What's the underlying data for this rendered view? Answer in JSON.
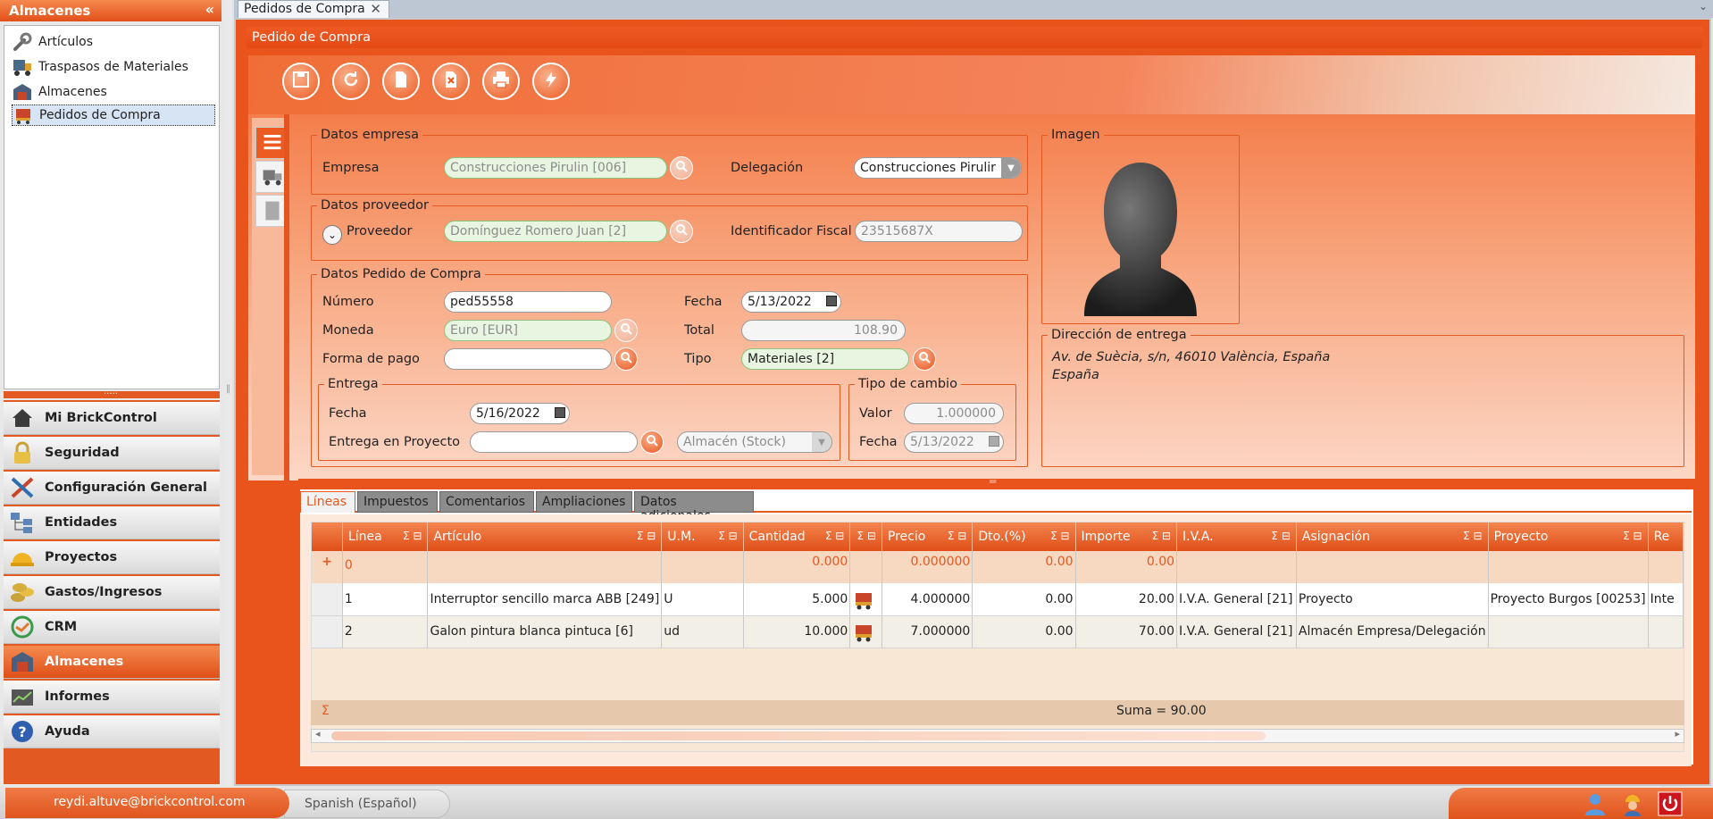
{
  "sidebar": {
    "title": "Almacenes",
    "collapse_icon": "«",
    "tree_items": [
      {
        "label": "Artículos",
        "icon": "wrench-icon"
      },
      {
        "label": "Traspasos de Materiales",
        "icon": "truck-icon"
      },
      {
        "label": "Almacenes",
        "icon": "warehouse-icon"
      },
      {
        "label": "Pedidos de Compra",
        "icon": "shopping-cart-icon"
      }
    ],
    "splitter_grip": ".....",
    "nav_items": [
      {
        "label": "Mi BrickControl",
        "icon": "house-icon"
      },
      {
        "label": "Seguridad",
        "icon": "padlock-icon"
      },
      {
        "label": "Configuración General",
        "icon": "tools-icon"
      },
      {
        "label": "Entidades",
        "icon": "org-chart-icon"
      },
      {
        "label": "Proyectos",
        "icon": "hard-hat-icon"
      },
      {
        "label": "Gastos/Ingresos",
        "icon": "coins-icon"
      },
      {
        "label": "CRM",
        "icon": "handshake-icon"
      },
      {
        "label": "Almacenes",
        "icon": "warehouse-icon"
      },
      {
        "label": "Informes",
        "icon": "report-chart-icon"
      },
      {
        "label": "Ayuda",
        "icon": "help-icon"
      }
    ],
    "active_nav": "Almacenes"
  },
  "tabs": {
    "main_tab": "Pedidos de Compra",
    "close_glyph": "✕",
    "menu_glyph": "⌄"
  },
  "panel": {
    "title": "Pedido de Compra"
  },
  "toolbar": {
    "buttons": [
      "save-icon",
      "refresh-icon",
      "new-document-icon",
      "delete-icon",
      "print-icon",
      "action-bolt-icon"
    ]
  },
  "form": {
    "datos_empresa": {
      "legend": "Datos empresa",
      "empresa_label": "Empresa",
      "empresa_value": "Construcciones Pirulin [006]",
      "delegacion_label": "Delegación",
      "delegacion_value": "Construcciones Pirulir"
    },
    "datos_proveedor": {
      "legend": "Datos proveedor",
      "proveedor_label": "Proveedor",
      "proveedor_value": "Domínguez Romero Juan [2]",
      "identificador_label": "Identificador Fiscal",
      "identificador_value": "23515687X"
    },
    "datos_pedido": {
      "legend": "Datos Pedido de Compra",
      "numero_label": "Número",
      "numero_value": "ped55558",
      "fecha_label": "Fecha",
      "fecha_value": "5/13/2022",
      "moneda_label": "Moneda",
      "moneda_value": "Euro [EUR]",
      "total_label": "Total",
      "total_value": "108.90",
      "forma_pago_label": "Forma de pago",
      "forma_pago_value": "",
      "tipo_label": "Tipo",
      "tipo_value": "Materiales [2]"
    },
    "entrega": {
      "legend": "Entrega",
      "fecha_label": "Fecha",
      "fecha_value": "5/16/2022",
      "proyecto_label": "Entrega en Proyecto",
      "proyecto_value": "",
      "almacen_value": "Almacén (Stock)"
    },
    "tipo_cambio": {
      "legend": "Tipo de cambio",
      "valor_label": "Valor",
      "valor_value": "1.000000",
      "fecha_label": "Fecha",
      "fecha_value": "5/13/2022"
    },
    "imagen": {
      "legend": "Imagen"
    },
    "direccion": {
      "legend": "Dirección de entrega",
      "line1": "Av. de Suècia, s/n, 46010 València, España",
      "line2": "España"
    }
  },
  "lower_tabs": [
    "Líneas",
    "Impuestos",
    "Comentarios",
    "Ampliaciones",
    "Datos adicionales"
  ],
  "grid": {
    "sigma_glyph": "Σ",
    "columns": [
      "Línea",
      "Artículo",
      "U.M.",
      "Cantidad",
      "",
      "Precio",
      "Dto.(%)",
      "Importe",
      "I.V.A.",
      "Asignación",
      "Proyecto",
      "Re"
    ],
    "totals_row": {
      "add_glyph": "+",
      "linea": "0",
      "cantidad": "0.000",
      "precio": "0.000000",
      "dto": "0.00",
      "importe": "0.00"
    },
    "rows": [
      {
        "linea": "1",
        "articulo": "Interruptor sencillo marca ABB [249]",
        "um": "U",
        "cantidad": "5.000",
        "precio": "4.000000",
        "dto": "0.00",
        "importe": "20.00",
        "iva": "I.V.A. General [21]",
        "asignacion": "Proyecto",
        "proyecto": "Proyecto Burgos [00253]",
        "re": "Inte"
      },
      {
        "linea": "2",
        "articulo": "Galon pintura blanca pintuca [6]",
        "um": "ud",
        "cantidad": "10.000",
        "precio": "7.000000",
        "dto": "0.00",
        "importe": "70.00",
        "iva": "I.V.A. General [21]",
        "asignacion": "Almacén Empresa/Delegación",
        "proyecto": "",
        "re": ""
      }
    ],
    "sum_text": "Suma = 90.00",
    "scroll_left": "◂",
    "scroll_right": "▸"
  },
  "status": {
    "user": "reydi.altuve@brickcontrol.com",
    "language": "Spanish (Español)",
    "icons": [
      "user-profile-icon",
      "worker-icon",
      "power-off-icon"
    ]
  },
  "colors": {
    "accent": "#e9541c",
    "accent_light": "#f8a983",
    "selection": "#d6e4f4"
  }
}
